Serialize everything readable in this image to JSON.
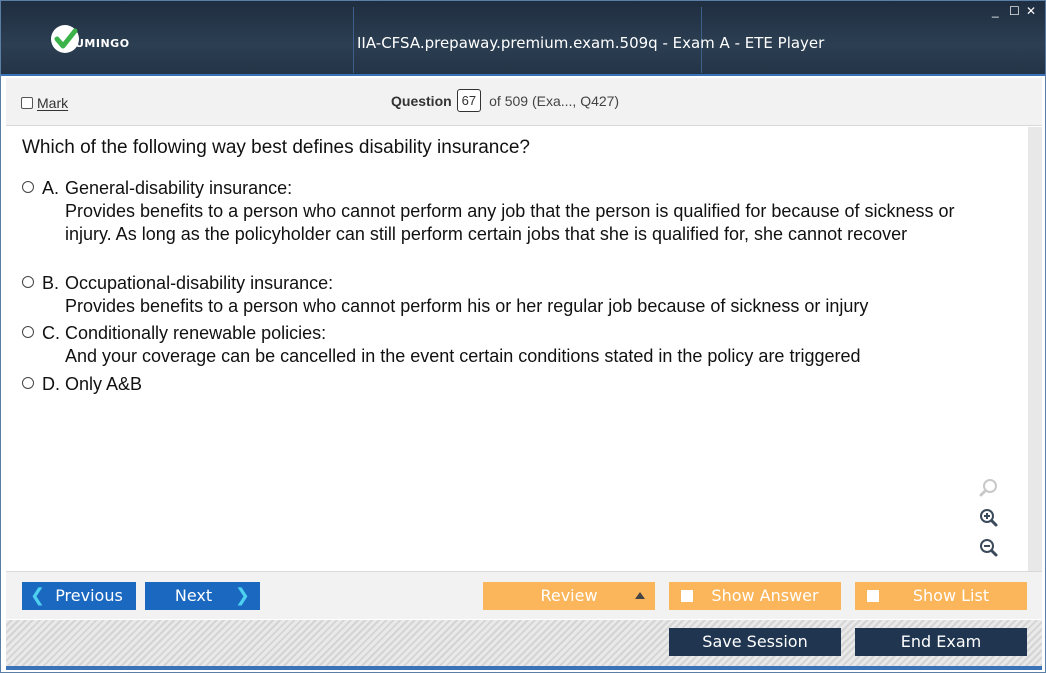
{
  "app": {
    "logo_text": "UMINGO",
    "window_title": "IIA-CFSA.prepaway.premium.exam.509q - Exam A - ETE Player",
    "controls": {
      "minimize": "_",
      "maximize": "☐",
      "close": "✕"
    }
  },
  "header": {
    "mark_label": "Mark",
    "question_label": "Question",
    "question_number": "67",
    "of_text": "of 509 (Exa..., Q427)"
  },
  "question": {
    "text": "Which of the following way best defines disability insurance?",
    "options": [
      {
        "letter": "A.",
        "title": "General-disability insurance:",
        "desc": "Provides benefits to a person who cannot perform any job that the person is qualified for because of sickness or injury. As long as the policyholder can still perform certain jobs that she is qualified for, she cannot recover"
      },
      {
        "letter": "B.",
        "title": "Occupational-disability insurance:",
        "desc": "Provides benefits to a person who cannot perform his or her regular job because of sickness or injury"
      },
      {
        "letter": "C.",
        "title": "Conditionally renewable policies:",
        "desc": "And your coverage can be cancelled in the event certain conditions stated in the policy are triggered"
      },
      {
        "letter": "D.",
        "title": "Only A&B",
        "desc": ""
      }
    ]
  },
  "nav": {
    "previous": "Previous",
    "next": "Next",
    "review": "Review",
    "show_answer": "Show Answer",
    "show_list": "Show List",
    "save_session": "Save Session",
    "end_exam": "End Exam"
  },
  "colors": {
    "titlebar": "#243447",
    "accent_blue": "#1b68c0",
    "orange": "#fbb55a",
    "dark_button": "#1f3550",
    "logo_green": "#3bb34a"
  }
}
